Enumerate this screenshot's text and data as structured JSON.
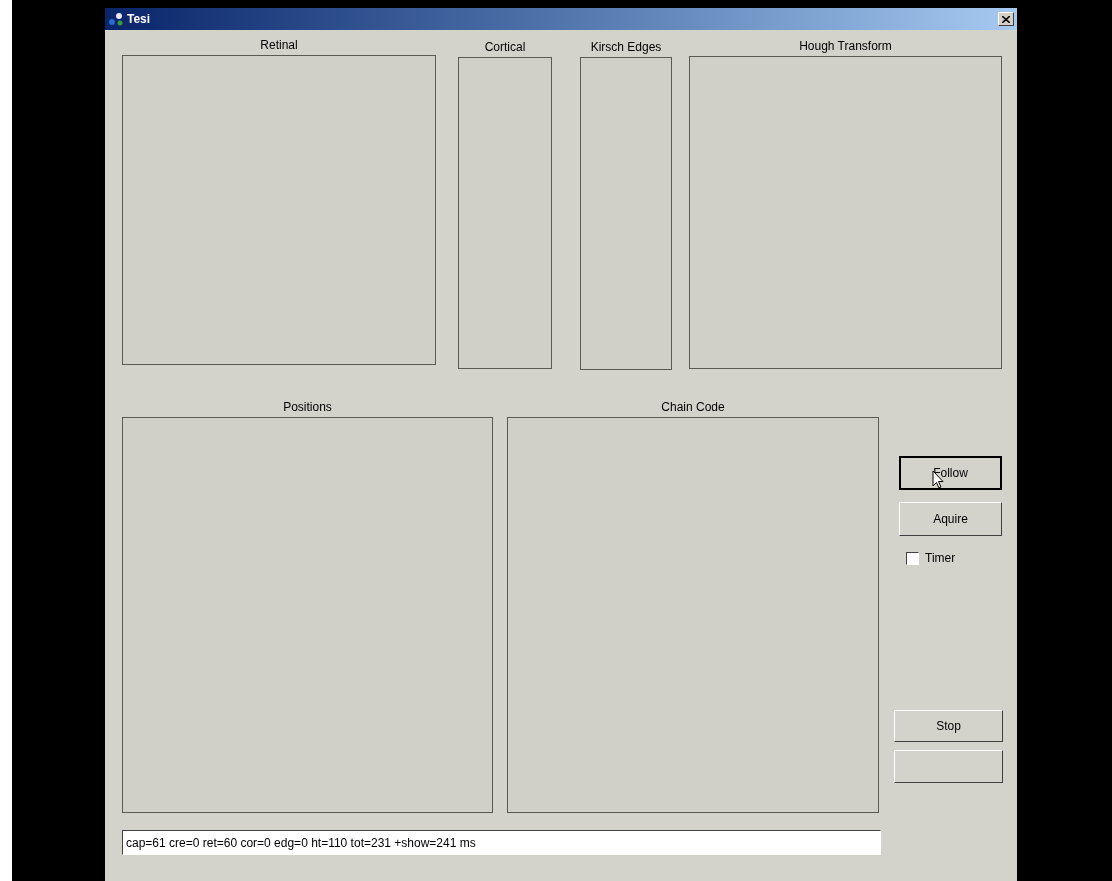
{
  "window": {
    "title": "Tesi"
  },
  "top_panels": [
    {
      "label": "Retinal"
    },
    {
      "label": "Cortical"
    },
    {
      "label": "Kirsch Edges"
    },
    {
      "label": "Hough Transform"
    }
  ],
  "bottom_panels": [
    {
      "label": "Positions"
    },
    {
      "label": "Chain Code"
    }
  ],
  "buttons": [
    {
      "label": "Follow",
      "focused": true
    },
    {
      "label": "Aquire",
      "focused": false
    }
  ],
  "timer": {
    "label": "Timer",
    "checked": false
  },
  "stop_button": {
    "label": "Stop"
  },
  "status": {
    "value": "cap=61 cre=0 ret=60 cor=0 edg=0 ht=110 tot=231 +show=241 ms"
  }
}
